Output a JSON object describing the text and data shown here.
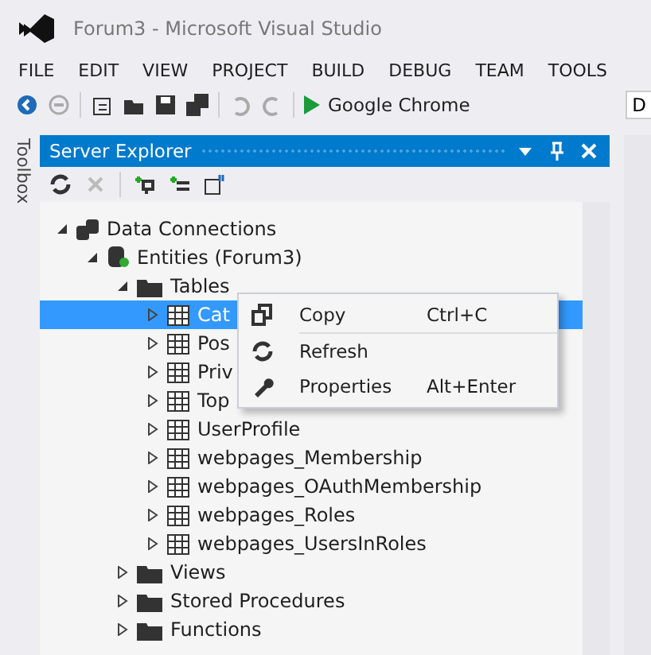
{
  "window": {
    "title": "Forum3 - Microsoft Visual Studio"
  },
  "menu": [
    "FILE",
    "EDIT",
    "VIEW",
    "PROJECT",
    "BUILD",
    "DEBUG",
    "TEAM",
    "TOOLS"
  ],
  "toolbar": {
    "run_target": "Google Chrome",
    "config_field": "D"
  },
  "side_tab": "Toolbox",
  "panel": {
    "title": "Server Explorer",
    "tree": [
      {
        "label": "Data Connections",
        "kind": "connections",
        "expanded": true,
        "selected": false,
        "children": [
          {
            "label": "Entities (Forum3)",
            "kind": "database",
            "expanded": true,
            "selected": false,
            "children": [
              {
                "label": "Tables",
                "kind": "folder",
                "expanded": true,
                "selected": false,
                "children": [
                  {
                    "label": "Cat",
                    "kind": "table",
                    "expanded": false,
                    "selected": true
                  },
                  {
                    "label": "Pos",
                    "kind": "table",
                    "expanded": false,
                    "selected": false
                  },
                  {
                    "label": "Priv",
                    "kind": "table",
                    "expanded": false,
                    "selected": false
                  },
                  {
                    "label": "Top",
                    "kind": "table",
                    "expanded": false,
                    "selected": false
                  },
                  {
                    "label": "UserProfile",
                    "kind": "table",
                    "expanded": false,
                    "selected": false
                  },
                  {
                    "label": "webpages_Membership",
                    "kind": "table",
                    "expanded": false,
                    "selected": false
                  },
                  {
                    "label": "webpages_OAuthMembership",
                    "kind": "table",
                    "expanded": false,
                    "selected": false
                  },
                  {
                    "label": "webpages_Roles",
                    "kind": "table",
                    "expanded": false,
                    "selected": false
                  },
                  {
                    "label": "webpages_UsersInRoles",
                    "kind": "table",
                    "expanded": false,
                    "selected": false
                  }
                ]
              },
              {
                "label": "Views",
                "kind": "folder",
                "expanded": false,
                "selected": false
              },
              {
                "label": "Stored Procedures",
                "kind": "folder",
                "expanded": false,
                "selected": false
              },
              {
                "label": "Functions",
                "kind": "folder",
                "expanded": false,
                "selected": false
              }
            ]
          }
        ]
      }
    ]
  },
  "context_menu": [
    {
      "label": "Copy",
      "shortcut": "Ctrl+C",
      "kind": "copy"
    },
    {
      "label": "Refresh",
      "kind": "refresh"
    },
    {
      "label": "Properties",
      "shortcut": "Alt+Enter",
      "kind": "properties"
    }
  ]
}
